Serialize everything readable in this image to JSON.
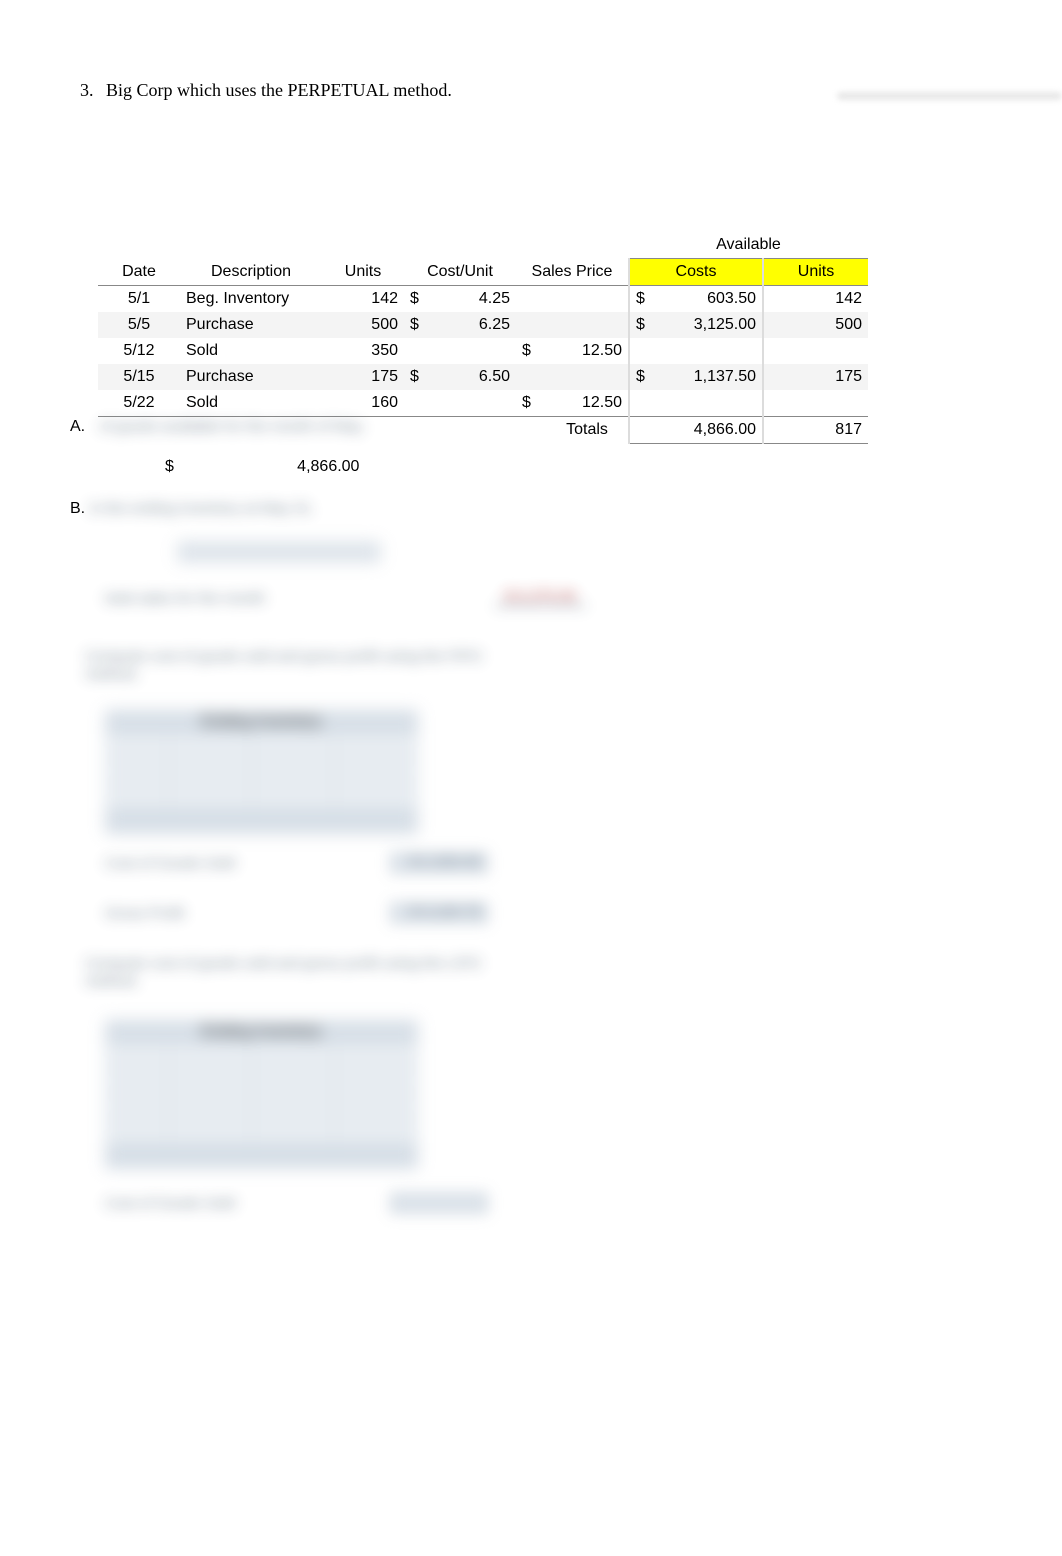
{
  "question": {
    "number": "3.",
    "text": "Big Corp which uses the PERPETUAL method."
  },
  "available_header": "Available",
  "headers": {
    "date": "Date",
    "desc": "Description",
    "units": "Units",
    "cost_unit": "Cost/Unit",
    "sales_price": "Sales Price",
    "costs": "Costs",
    "units2": "Units"
  },
  "rows": [
    {
      "date": "5/1",
      "desc": "Beg. Inventory",
      "units": "142",
      "cu_sym": "$",
      "cu": "4.25",
      "sp_sym": "",
      "sp": "",
      "c_sym": "$",
      "costs": "603.50",
      "au": "142"
    },
    {
      "date": "5/5",
      "desc": "Purchase",
      "units": "500",
      "cu_sym": "$",
      "cu": "6.25",
      "sp_sym": "",
      "sp": "",
      "c_sym": "$",
      "costs": "3,125.00",
      "au": "500"
    },
    {
      "date": "5/12",
      "desc": "Sold",
      "units": "350",
      "cu_sym": "",
      "cu": "",
      "sp_sym": "$",
      "sp": "12.50",
      "c_sym": "",
      "costs": "",
      "au": ""
    },
    {
      "date": "5/15",
      "desc": "Purchase",
      "units": "175",
      "cu_sym": "$",
      "cu": "6.50",
      "sp_sym": "",
      "sp": "",
      "c_sym": "$",
      "costs": "1,137.50",
      "au": "175"
    },
    {
      "date": "5/22",
      "desc": "Sold",
      "units": "160",
      "cu_sym": "",
      "cu": "",
      "sp_sym": "$",
      "sp": "12.50",
      "c_sym": "",
      "costs": "",
      "au": ""
    }
  ],
  "totals": {
    "label": "Totals",
    "costs": "4,866.00",
    "units": "817"
  },
  "partA": {
    "label": "A.",
    "value": "4,866.00",
    "currency": "$"
  },
  "partB": {
    "label": "B."
  },
  "blurred": {
    "a_text": "of goods available for the month of May.",
    "b_text": "in the ending inventory at May 31.",
    "sales_label": "total sales for the month",
    "sales_val": "$ 6,375.00",
    "c_text": "Compute cost of goods sold and gross profit using the FIFO method.",
    "d_text": "Compute cost of goods sold and gross profit using the LIFO method.",
    "ei_header": "Ending Inventory",
    "cogs_label": "Cost of Goods Sold",
    "gp_label": "Gross Profit",
    "cogs_val": "$ 2,300.00",
    "gp_val": "$ 3,100.75"
  }
}
